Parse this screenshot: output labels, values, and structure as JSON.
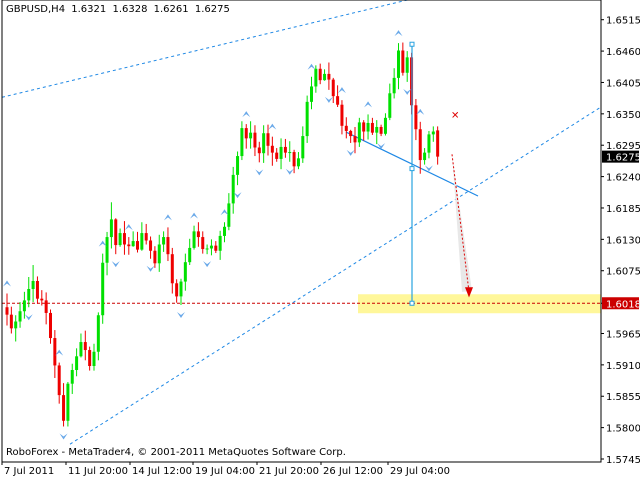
{
  "header": {
    "symbol": "GBPUSD,H4",
    "open": "1.6321",
    "high": "1.6328",
    "low": "1.6261",
    "close": "1.6275"
  },
  "copyright": "RoboForex - MetaTrader4, © 2001-2011 MetaQuotes Software Corp.",
  "colors": {
    "bull": "#00e000",
    "bear": "#ee0000",
    "channel": "#1e88e5",
    "target_zone": "#fff79a",
    "target_line": "#cc0000",
    "axis": "#000000"
  },
  "chart_data": {
    "type": "candlestick",
    "title": "",
    "xlabel": "",
    "ylabel": "",
    "ylim": [
      1.5745,
      1.6525
    ],
    "y_ticks": [
      "1.6515",
      "1.6460",
      "1.6405",
      "1.6350",
      "1.6295",
      "1.6240",
      "1.6185",
      "1.6130",
      "1.6075",
      "1.6018",
      "1.5965",
      "1.5910",
      "1.5855",
      "1.5800",
      "1.5745"
    ],
    "x_ticks": [
      "7 Jul 2011",
      "11 Jul 20:00",
      "14 Jul 12:00",
      "19 Jul 04:00",
      "21 Jul 20:00",
      "26 Jul 12:00",
      "29 Jul 04:00"
    ],
    "current_price": "1.6275",
    "target_price": "1.6018",
    "channel": {
      "upper_start": 1.6379,
      "upper_end": 1.6631,
      "lower_start": 1.5771,
      "lower_end": 1.6362
    },
    "annotations": [
      "target zone 1.6018",
      "pattern vertical line",
      "stop level marker"
    ],
    "candles": [
      [
        1.6011,
        1.5998,
        1.6035,
        1.5979
      ],
      [
        1.5998,
        1.5974,
        1.6012,
        1.5965
      ],
      [
        1.5974,
        1.5986,
        1.5997,
        1.5951
      ],
      [
        1.5986,
        1.6004,
        1.602,
        1.5975
      ],
      [
        1.6004,
        1.6023,
        1.6038,
        1.5991
      ],
      [
        1.6023,
        1.6043,
        1.6064,
        1.6011
      ],
      [
        1.6043,
        1.6057,
        1.6085,
        1.602
      ],
      [
        1.6057,
        1.6026,
        1.6065,
        1.6017
      ],
      [
        1.6026,
        1.6023,
        1.6041,
        1.6014
      ],
      [
        1.6023,
        1.6001,
        1.6037,
        1.5981
      ],
      [
        1.6001,
        1.5957,
        1.6007,
        1.5947
      ],
      [
        1.5957,
        1.5909,
        1.5971,
        1.5887
      ],
      [
        1.5909,
        1.5857,
        1.5914,
        1.5842
      ],
      [
        1.5857,
        1.5812,
        1.5878,
        1.5802
      ],
      [
        1.5812,
        1.5877,
        1.588,
        1.5802
      ],
      [
        1.5877,
        1.5901,
        1.5912,
        1.5859
      ],
      [
        1.5901,
        1.5925,
        1.5939,
        1.589
      ],
      [
        1.5925,
        1.595,
        1.5965,
        1.5923
      ],
      [
        1.595,
        1.5936,
        1.597,
        1.5918
      ],
      [
        1.5936,
        1.5908,
        1.5942,
        1.59
      ],
      [
        1.5908,
        1.5933,
        1.5947,
        1.59
      ],
      [
        1.5933,
        1.5997,
        1.6002,
        1.5918
      ],
      [
        1.5997,
        1.6089,
        1.6105,
        1.5982
      ],
      [
        1.6089,
        1.6134,
        1.6143,
        1.6067
      ],
      [
        1.6134,
        1.6165,
        1.6195,
        1.6114
      ],
      [
        1.6165,
        1.612,
        1.6167,
        1.6104
      ],
      [
        1.612,
        1.6141,
        1.6149,
        1.6117
      ],
      [
        1.6141,
        1.6121,
        1.6162,
        1.6103
      ],
      [
        1.6121,
        1.6118,
        1.6134,
        1.6103
      ],
      [
        1.6118,
        1.6127,
        1.6144,
        1.6117
      ],
      [
        1.6127,
        1.6112,
        1.6143,
        1.6107
      ],
      [
        1.6112,
        1.6141,
        1.616,
        1.611
      ],
      [
        1.6141,
        1.6128,
        1.6157,
        1.6121
      ],
      [
        1.6128,
        1.611,
        1.6135,
        1.6096
      ],
      [
        1.611,
        1.6088,
        1.6118,
        1.608
      ],
      [
        1.6088,
        1.6121,
        1.6138,
        1.6073
      ],
      [
        1.6121,
        1.6134,
        1.6144,
        1.6108
      ],
      [
        1.6134,
        1.6104,
        1.6151,
        1.6092
      ],
      [
        1.6104,
        1.6053,
        1.6115,
        1.6035
      ],
      [
        1.6053,
        1.603,
        1.606,
        1.6019
      ],
      [
        1.603,
        1.6056,
        1.6061,
        1.6015
      ],
      [
        1.6056,
        1.609,
        1.6105,
        1.604
      ],
      [
        1.609,
        1.6115,
        1.6131,
        1.6085
      ],
      [
        1.6115,
        1.6144,
        1.6154,
        1.6112
      ],
      [
        1.6144,
        1.6134,
        1.616,
        1.6117
      ],
      [
        1.6134,
        1.6113,
        1.6144,
        1.6105
      ],
      [
        1.6113,
        1.6114,
        1.6121,
        1.6104
      ],
      [
        1.6114,
        1.6119,
        1.613,
        1.6102
      ],
      [
        1.6119,
        1.611,
        1.6127,
        1.6106
      ],
      [
        1.611,
        1.6136,
        1.6145,
        1.6094
      ],
      [
        1.6136,
        1.6152,
        1.616,
        1.6125
      ],
      [
        1.6152,
        1.6193,
        1.6211,
        1.6146
      ],
      [
        1.6193,
        1.6243,
        1.6257,
        1.6175
      ],
      [
        1.6243,
        1.6276,
        1.6284,
        1.6225
      ],
      [
        1.6276,
        1.6325,
        1.6337,
        1.6269
      ],
      [
        1.6325,
        1.6307,
        1.6332,
        1.6289
      ],
      [
        1.6307,
        1.6317,
        1.6337,
        1.6289
      ],
      [
        1.6317,
        1.6291,
        1.633,
        1.6276
      ],
      [
        1.6291,
        1.6281,
        1.6301,
        1.6265
      ],
      [
        1.6281,
        1.6316,
        1.633,
        1.6264
      ],
      [
        1.6316,
        1.6294,
        1.6331,
        1.6277
      ],
      [
        1.6294,
        1.6282,
        1.631,
        1.6259
      ],
      [
        1.6282,
        1.6271,
        1.629,
        1.6266
      ],
      [
        1.6271,
        1.6292,
        1.6307,
        1.6253
      ],
      [
        1.6292,
        1.6282,
        1.6306,
        1.6273
      ],
      [
        1.6282,
        1.6283,
        1.6302,
        1.6266
      ],
      [
        1.6283,
        1.6258,
        1.6287,
        1.6246
      ],
      [
        1.6258,
        1.6272,
        1.6283,
        1.6253
      ],
      [
        1.6272,
        1.6311,
        1.6328,
        1.6264
      ],
      [
        1.6311,
        1.6371,
        1.6382,
        1.6299
      ],
      [
        1.6371,
        1.6398,
        1.6415,
        1.6358
      ],
      [
        1.6398,
        1.6429,
        1.6435,
        1.6387
      ],
      [
        1.6429,
        1.6409,
        1.6438,
        1.6402
      ],
      [
        1.6409,
        1.642,
        1.6428,
        1.6408
      ],
      [
        1.642,
        1.641,
        1.644,
        1.6392
      ],
      [
        1.641,
        1.6381,
        1.6413,
        1.6369
      ],
      [
        1.6381,
        1.6366,
        1.64,
        1.6362
      ],
      [
        1.6366,
        1.6329,
        1.6374,
        1.6314
      ],
      [
        1.6329,
        1.632,
        1.6344,
        1.6307
      ],
      [
        1.632,
        1.6311,
        1.6322,
        1.6299
      ],
      [
        1.6311,
        1.63,
        1.6327,
        1.6281
      ],
      [
        1.63,
        1.6335,
        1.6343,
        1.6292
      ],
      [
        1.6335,
        1.6319,
        1.6339,
        1.6303
      ],
      [
        1.6319,
        1.6334,
        1.6349,
        1.6305
      ],
      [
        1.6334,
        1.6317,
        1.6343,
        1.6313
      ],
      [
        1.6317,
        1.6327,
        1.6339,
        1.6297
      ],
      [
        1.6327,
        1.6315,
        1.6331,
        1.6311
      ],
      [
        1.6315,
        1.6343,
        1.6351,
        1.6312
      ],
      [
        1.6343,
        1.6386,
        1.6403,
        1.6339
      ],
      [
        1.6386,
        1.6413,
        1.643,
        1.6377
      ],
      [
        1.6413,
        1.6461,
        1.6474,
        1.6393
      ],
      [
        1.6461,
        1.6422,
        1.6475,
        1.6417
      ],
      [
        1.6422,
        1.6449,
        1.646,
        1.6406
      ],
      [
        1.6449,
        1.6365,
        1.6457,
        1.6349
      ],
      [
        1.6365,
        1.6323,
        1.6376,
        1.6304
      ],
      [
        1.6323,
        1.6269,
        1.6336,
        1.6245
      ],
      [
        1.6269,
        1.6282,
        1.629,
        1.6261
      ],
      [
        1.6282,
        1.6314,
        1.632,
        1.6272
      ],
      [
        1.6314,
        1.6319,
        1.6328,
        1.6301
      ],
      [
        1.6321,
        1.6275,
        1.6328,
        1.6261
      ]
    ]
  }
}
